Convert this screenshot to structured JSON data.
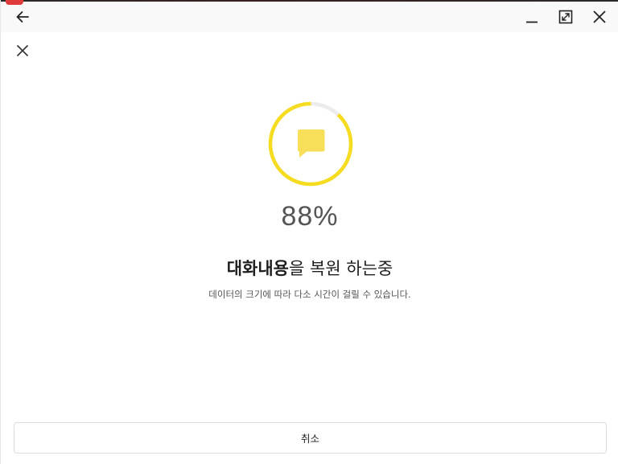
{
  "window": {
    "controls": {
      "back_icon": "arrow-left-icon",
      "minimize_icon": "minimize-icon",
      "maximize_icon": "maximize-icon",
      "close_icon": "close-icon"
    }
  },
  "dialog": {
    "close_icon": "close-icon",
    "progress": {
      "value": 0.88,
      "label": "88%",
      "icon": "chat-bubble-icon",
      "accent_color": "#f5dc1e",
      "track_color": "#ececec"
    },
    "title_bold": "대화내용",
    "title_rest": "을 복원 하는중",
    "subtitle": "데이터의 크기에 따라 다소 시간이 걸릴 수 있습니다.",
    "cancel_label": "취소"
  }
}
